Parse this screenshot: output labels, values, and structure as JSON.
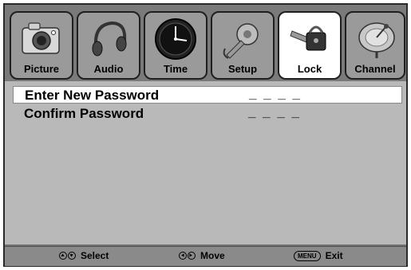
{
  "tabs": [
    {
      "label": "Picture",
      "icon": "camera-icon",
      "active": false
    },
    {
      "label": "Audio",
      "icon": "headphones-icon",
      "active": false
    },
    {
      "label": "Time",
      "icon": "clock-icon",
      "active": false
    },
    {
      "label": "Setup",
      "icon": "gear-icon",
      "active": false
    },
    {
      "label": "Lock",
      "icon": "lock-icon",
      "active": true
    },
    {
      "label": "Channel",
      "icon": "satellite-dish-icon",
      "active": false
    }
  ],
  "fields": [
    {
      "label": "Enter New Password",
      "value": "_ _ _ _",
      "selected": true
    },
    {
      "label": "Confirm Password",
      "value": "_ _ _ _",
      "selected": false
    }
  ],
  "footer": {
    "select_label": "Select",
    "move_label": "Move",
    "menu_key": "MENU",
    "exit_label": "Exit"
  },
  "colors": {
    "tab_inactive": "#9a9a9a",
    "tab_active": "#ffffff",
    "content_bg": "#b9b9b9"
  }
}
